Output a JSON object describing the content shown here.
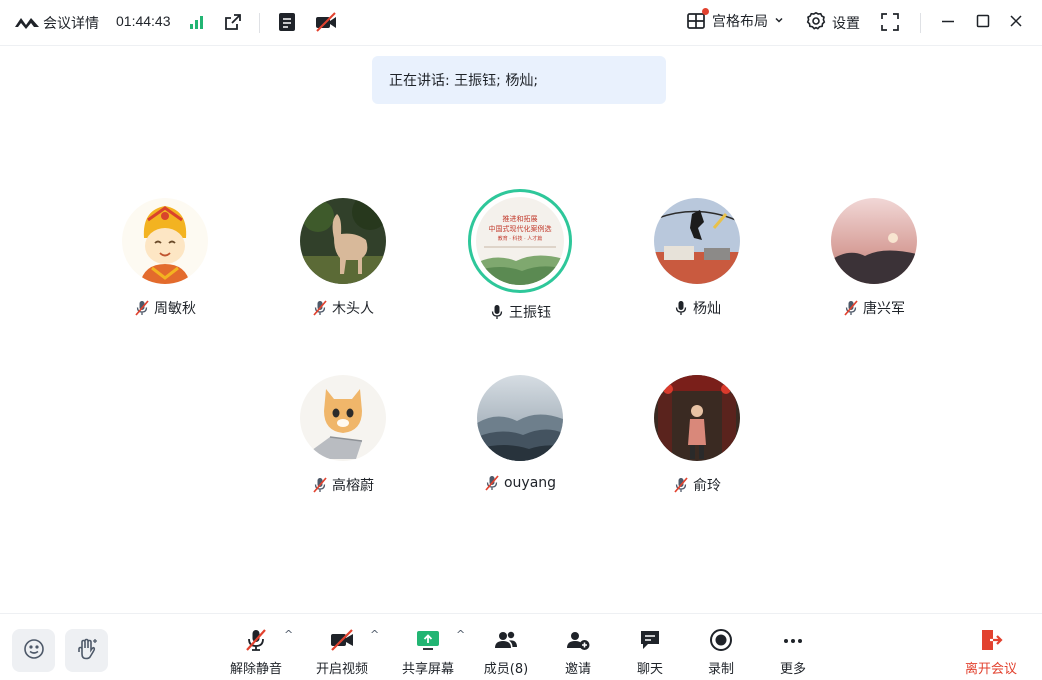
{
  "header": {
    "title": "会议详情",
    "timer": "01:44:43",
    "layout_label": "宫格布局",
    "settings_label": "设置"
  },
  "banner": {
    "speaking_text": "正在讲话: 王振钰; 杨灿;"
  },
  "participants": [
    {
      "name": "周敏秋",
      "muted": true
    },
    {
      "name": "木头人",
      "muted": true
    },
    {
      "name": "王振钰",
      "muted": false,
      "speaking": true
    },
    {
      "name": "杨灿",
      "muted": false
    },
    {
      "name": "唐兴军",
      "muted": true
    },
    {
      "name": "高榕蔚",
      "muted": true
    },
    {
      "name": "ouyang",
      "muted": true
    },
    {
      "name": "俞玲",
      "muted": true
    }
  ],
  "avatar_poster": {
    "line1": "推进和拓展",
    "line2": "中国式现代化案例选",
    "line3": "教育 · 科技 · 人才篇"
  },
  "toolbar": {
    "unmute": "解除静音",
    "start_video": "开启视频",
    "share_screen": "共享屏幕",
    "members": "成员(8)",
    "invite": "邀请",
    "chat": "聊天",
    "record": "录制",
    "more": "更多",
    "leave": "离开会议"
  },
  "colors": {
    "accent_green": "#2ec79a",
    "signal_green": "#22b573",
    "danger_red": "#e2422f",
    "banner_bg": "#e9f1fd"
  }
}
